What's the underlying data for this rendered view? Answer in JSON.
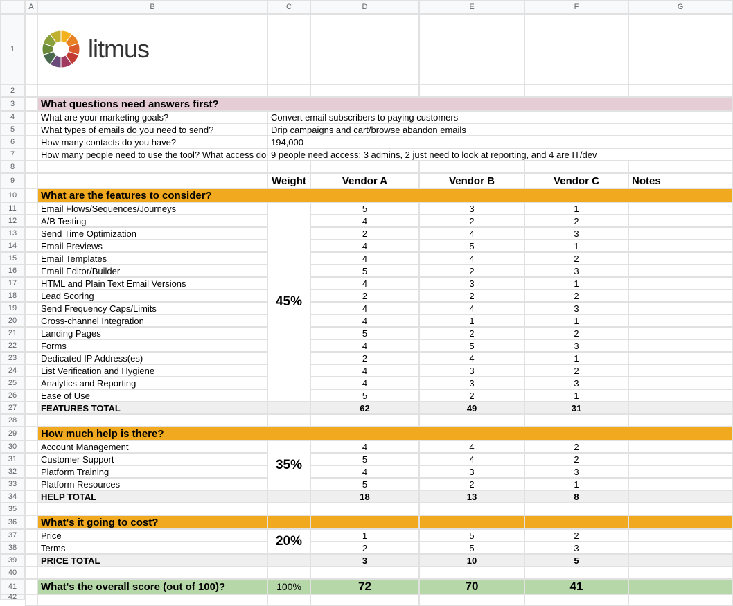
{
  "brand": "litmus",
  "columns": [
    "A",
    "B",
    "C",
    "D",
    "E",
    "F",
    "G"
  ],
  "rows": [
    "1",
    "2",
    "3",
    "4",
    "5",
    "6",
    "7",
    "8",
    "9",
    "10",
    "11",
    "12",
    "13",
    "14",
    "15",
    "16",
    "17",
    "18",
    "19",
    "20",
    "21",
    "22",
    "23",
    "24",
    "25",
    "26",
    "27",
    "28",
    "29",
    "30",
    "31",
    "32",
    "33",
    "34",
    "35",
    "36",
    "37",
    "38",
    "39",
    "40",
    "41",
    "42"
  ],
  "q_section": "What questions need answers first?",
  "q": [
    {
      "label": "What are your marketing goals?",
      "answer": "Convert email subscribers to paying customers"
    },
    {
      "label": "What types of emails do you need to send?",
      "answer": "Drip campaigns and cart/browse abandon emails"
    },
    {
      "label": "How many contacts do you have?",
      "answer": "194,000"
    },
    {
      "label": "How many people need to use the tool? What access do they need?",
      "answer": "9 people need access: 3 admins, 2 just need to look at reporting, and 4 are IT/dev"
    }
  ],
  "header": {
    "weight": "Weight",
    "va": "Vendor A",
    "vb": "Vendor B",
    "vc": "Vendor C",
    "notes": "Notes"
  },
  "features_section": "What are the features to consider?",
  "features_weight": "45%",
  "features": [
    {
      "label": "Email Flows/Sequences/Journeys",
      "a": "5",
      "b": "3",
      "c": "1"
    },
    {
      "label": "A/B Testing",
      "a": "4",
      "b": "2",
      "c": "2"
    },
    {
      "label": "Send Time Optimization",
      "a": "2",
      "b": "4",
      "c": "3"
    },
    {
      "label": "Email Previews",
      "a": "4",
      "b": "5",
      "c": "1"
    },
    {
      "label": "Email Templates",
      "a": "4",
      "b": "4",
      "c": "2"
    },
    {
      "label": "Email Editor/Builder",
      "a": "5",
      "b": "2",
      "c": "3"
    },
    {
      "label": "HTML and Plain Text Email Versions",
      "a": "4",
      "b": "3",
      "c": "1"
    },
    {
      "label": "Lead Scoring",
      "a": "2",
      "b": "2",
      "c": "2"
    },
    {
      "label": "Send Frequency Caps/Limits",
      "a": "4",
      "b": "4",
      "c": "3"
    },
    {
      "label": "Cross-channel Integration",
      "a": "4",
      "b": "1",
      "c": "1"
    },
    {
      "label": "Landing Pages",
      "a": "5",
      "b": "2",
      "c": "2"
    },
    {
      "label": "Forms",
      "a": "4",
      "b": "5",
      "c": "3"
    },
    {
      "label": "Dedicated IP Address(es)",
      "a": "2",
      "b": "4",
      "c": "1"
    },
    {
      "label": "List Verification and Hygiene",
      "a": "4",
      "b": "3",
      "c": "2"
    },
    {
      "label": "Analytics and Reporting",
      "a": "4",
      "b": "3",
      "c": "3"
    },
    {
      "label": "Ease of Use",
      "a": "5",
      "b": "2",
      "c": "1"
    }
  ],
  "features_total_label": "FEATURES TOTAL",
  "features_total": {
    "a": "62",
    "b": "49",
    "c": "31"
  },
  "help_section": "How much help is there?",
  "help_weight": "35%",
  "help": [
    {
      "label": "Account Management",
      "a": "4",
      "b": "4",
      "c": "2"
    },
    {
      "label": "Customer Support",
      "a": "5",
      "b": "4",
      "c": "2"
    },
    {
      "label": "Platform Training",
      "a": "4",
      "b": "3",
      "c": "3"
    },
    {
      "label": "Platform Resources",
      "a": "5",
      "b": "2",
      "c": "1"
    }
  ],
  "help_total_label": "HELP TOTAL",
  "help_total": {
    "a": "18",
    "b": "13",
    "c": "8"
  },
  "cost_section": "What's it going to cost?",
  "cost_weight": "20%",
  "cost": [
    {
      "label": "Price",
      "a": "1",
      "b": "5",
      "c": "2"
    },
    {
      "label": "Terms",
      "a": "2",
      "b": "5",
      "c": "3"
    }
  ],
  "cost_total_label": "PRICE TOTAL",
  "cost_total": {
    "a": "3",
    "b": "10",
    "c": "5"
  },
  "score_label": "What's the overall score (out of 100)?",
  "score_weight": "100%",
  "score": {
    "a": "72",
    "b": "70",
    "c": "41"
  }
}
